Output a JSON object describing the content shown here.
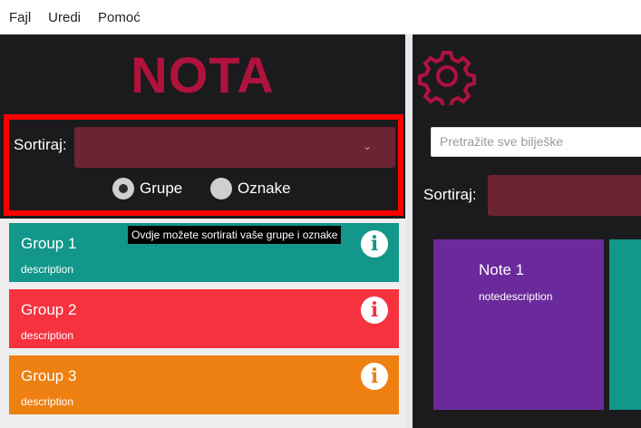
{
  "menu": [
    "Fajl",
    "Uredi",
    "Pomoć"
  ],
  "app": {
    "logo": "NOTA"
  },
  "left_sort": {
    "label": "Sortiraj:",
    "selected": "",
    "radio_groups": "Grupe",
    "radio_tags": "Oznake",
    "selected_radio": "Grupe"
  },
  "tooltip": "Ovdje možete sortirati vaše grupe i oznake",
  "groups": [
    {
      "name": "Group 1",
      "description": "description",
      "color": "#12978a"
    },
    {
      "name": "Group 2",
      "description": "description",
      "color": "#f7323f"
    },
    {
      "name": "Group 3",
      "description": "description",
      "color": "#ee8012"
    }
  ],
  "right": {
    "search_placeholder": "Pretražite sve bilješke",
    "sort_label": "Sortiraj:",
    "notes": [
      {
        "title": "Note 1",
        "description": "notedescription",
        "color": "#6b2a9b"
      },
      {
        "title": "",
        "description": "",
        "color": "#12978a"
      }
    ]
  },
  "colors": {
    "accent": "#b0123e",
    "highlight": "#ff0000",
    "background": "#1b1b1e"
  }
}
